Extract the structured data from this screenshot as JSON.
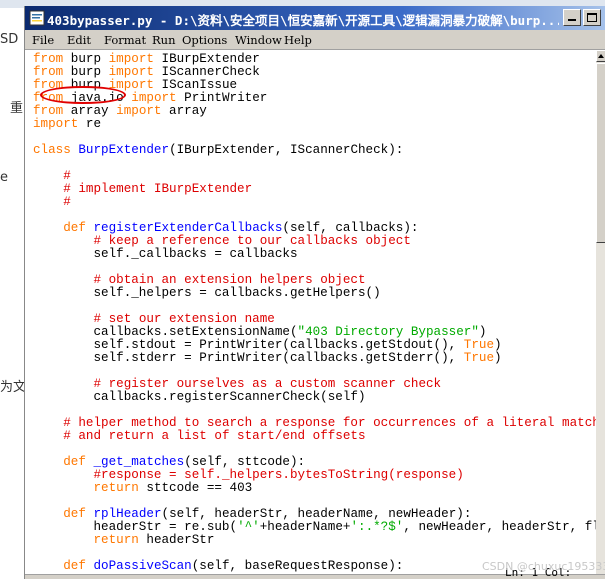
{
  "background": {
    "left_texts": [
      "SD",
      "重",
      "e",
      "为文"
    ]
  },
  "window": {
    "title": "403bypasser.py - D:\\资料\\安全项目\\恒安嘉新\\开源工具\\逻辑漏洞暴力破解\\burp...",
    "icon": "python-idle-icon",
    "minimize_label": "minimize",
    "maximize_label": "maximize"
  },
  "menu": [
    "File",
    "Edit",
    "Format",
    "Run",
    "Options",
    "Window",
    "Help"
  ],
  "editor": {
    "lines": [
      [
        [
          "kw",
          "from"
        ],
        [
          "n",
          " burp "
        ],
        [
          "kw",
          "import"
        ],
        [
          "n",
          " IBurpExtender"
        ]
      ],
      [
        [
          "kw",
          "from"
        ],
        [
          "n",
          " burp "
        ],
        [
          "kw",
          "import"
        ],
        [
          "n",
          " IScannerCheck"
        ]
      ],
      [
        [
          "kw",
          "from"
        ],
        [
          "n",
          " burp "
        ],
        [
          "kw",
          "import"
        ],
        [
          "n",
          " IScanIssue"
        ]
      ],
      [
        [
          "kw",
          "from"
        ],
        [
          "n",
          " java.io "
        ],
        [
          "kw",
          "import"
        ],
        [
          "n",
          " PrintWriter"
        ]
      ],
      [
        [
          "kw",
          "from"
        ],
        [
          "n",
          " array "
        ],
        [
          "kw",
          "import"
        ],
        [
          "n",
          " array"
        ]
      ],
      [
        [
          "kw",
          "import"
        ],
        [
          "n",
          " re"
        ]
      ],
      [],
      [
        [
          "kw",
          "class"
        ],
        [
          "n",
          " "
        ],
        [
          "def",
          "BurpExtender"
        ],
        [
          "n",
          "(IBurpExtender, IScannerCheck):"
        ]
      ],
      [],
      [
        [
          "n",
          "    "
        ],
        [
          "cmt",
          "#"
        ]
      ],
      [
        [
          "n",
          "    "
        ],
        [
          "cmt",
          "# implement IBurpExtender"
        ]
      ],
      [
        [
          "n",
          "    "
        ],
        [
          "cmt",
          "#"
        ]
      ],
      [],
      [
        [
          "n",
          "    "
        ],
        [
          "kw",
          "def"
        ],
        [
          "n",
          " "
        ],
        [
          "def",
          "registerExtenderCallbacks"
        ],
        [
          "n",
          "(self, callbacks):"
        ]
      ],
      [
        [
          "n",
          "        "
        ],
        [
          "cmt",
          "# keep a reference to our callbacks object"
        ]
      ],
      [
        [
          "n",
          "        self._callbacks = callbacks"
        ]
      ],
      [],
      [
        [
          "n",
          "        "
        ],
        [
          "cmt",
          "# obtain an extension helpers object"
        ]
      ],
      [
        [
          "n",
          "        self._helpers = callbacks.getHelpers()"
        ]
      ],
      [],
      [
        [
          "n",
          "        "
        ],
        [
          "cmt",
          "# set our extension name"
        ]
      ],
      [
        [
          "n",
          "        callbacks.setExtensionName("
        ],
        [
          "str",
          "\"403 Directory Bypasser\""
        ],
        [
          "n",
          ")"
        ]
      ],
      [
        [
          "n",
          "        self.stdout = PrintWriter(callbacks.getStdout(), "
        ],
        [
          "kw",
          "True"
        ],
        [
          "n",
          ")"
        ]
      ],
      [
        [
          "n",
          "        self.stderr = PrintWriter(callbacks.getStderr(), "
        ],
        [
          "kw",
          "True"
        ],
        [
          "n",
          ")"
        ]
      ],
      [],
      [
        [
          "n",
          "        "
        ],
        [
          "cmt",
          "# register ourselves as a custom scanner check"
        ]
      ],
      [
        [
          "n",
          "        callbacks.registerScannerCheck(self)"
        ]
      ],
      [],
      [
        [
          "n",
          "    "
        ],
        [
          "cmt",
          "# helper method to search a response for occurrences of a literal match stri"
        ]
      ],
      [
        [
          "n",
          "    "
        ],
        [
          "cmt",
          "# and return a list of start/end offsets"
        ]
      ],
      [],
      [
        [
          "n",
          "    "
        ],
        [
          "kw",
          "def"
        ],
        [
          "n",
          " "
        ],
        [
          "def",
          "_get_matches"
        ],
        [
          "n",
          "(self, sttcode):"
        ]
      ],
      [
        [
          "n",
          "        "
        ],
        [
          "cmt",
          "#response = self._helpers.bytesToString(response)"
        ]
      ],
      [
        [
          "n",
          "        "
        ],
        [
          "kw",
          "return"
        ],
        [
          "n",
          " sttcode == 403"
        ]
      ],
      [],
      [
        [
          "n",
          "    "
        ],
        [
          "kw",
          "def"
        ],
        [
          "n",
          " "
        ],
        [
          "def",
          "rplHeader"
        ],
        [
          "n",
          "(self, headerStr, headerName, newHeader):"
        ]
      ],
      [
        [
          "n",
          "        headerStr = re.sub("
        ],
        [
          "str",
          "'^'"
        ],
        [
          "n",
          "+headerName+"
        ],
        [
          "str",
          "':.*?$'"
        ],
        [
          "n",
          ", newHeader, headerStr, flags=r"
        ]
      ],
      [
        [
          "n",
          "        "
        ],
        [
          "kw",
          "return"
        ],
        [
          "n",
          " headerStr"
        ]
      ],
      [],
      [
        [
          "n",
          "    "
        ],
        [
          "kw",
          "def"
        ],
        [
          "n",
          " "
        ],
        [
          "def",
          "doPassiveScan"
        ],
        [
          "n",
          "(self, baseRequestResponse):"
        ]
      ]
    ]
  },
  "status": {
    "position": "Ln: 1  Col:"
  },
  "watermark": "CSDN @chuxuc195333",
  "colors": {
    "keyword": "#ff7700",
    "string": "#00aa00",
    "comment": "#dd0000",
    "definition": "#0000ff",
    "annotation": "#e00000"
  }
}
